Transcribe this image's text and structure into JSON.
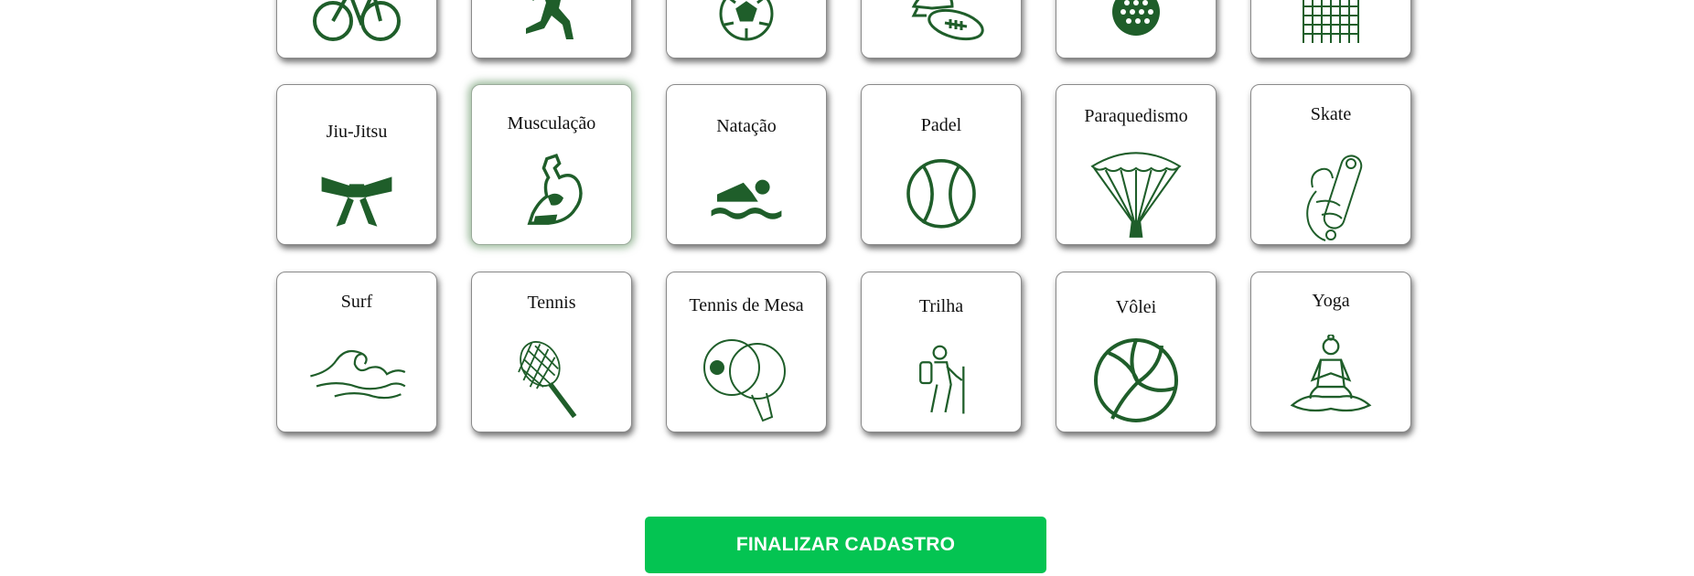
{
  "colors": {
    "icon_green": "#1f5e2a",
    "button_green": "#04c452",
    "label": "#111111"
  },
  "row_partial": [
    {
      "icon": "bicycle-icon"
    },
    {
      "icon": "runner-icon"
    },
    {
      "icon": "soccer-ball-icon"
    },
    {
      "icon": "football-helmet-icon"
    },
    {
      "icon": "golf-ball-icon"
    },
    {
      "icon": "goal-net-icon"
    }
  ],
  "row_middle": [
    {
      "label": "Jiu-Jitsu",
      "icon": "belt-icon"
    },
    {
      "label": "Musculação",
      "icon": "flexed-arm-icon",
      "selected": true
    },
    {
      "label": "Natação",
      "icon": "swimmer-icon"
    },
    {
      "label": "Padel",
      "icon": "padel-ball-icon"
    },
    {
      "label": "Paraquedismo",
      "icon": "parachute-icon"
    },
    {
      "label": "Skate",
      "icon": "skater-icon"
    }
  ],
  "row_bottom": [
    {
      "label": "Surf",
      "icon": "wave-icon"
    },
    {
      "label": "Tennis",
      "icon": "tennis-racket-icon"
    },
    {
      "label": "Tennis de Mesa",
      "icon": "ping-pong-paddles-icon"
    },
    {
      "label": "Trilha",
      "icon": "hiker-icon"
    },
    {
      "label": "Vôlei",
      "icon": "volleyball-icon"
    },
    {
      "label": "Yoga",
      "icon": "yoga-icon"
    }
  ],
  "finish_button": {
    "label": "FINALIZAR CADASTRO"
  }
}
